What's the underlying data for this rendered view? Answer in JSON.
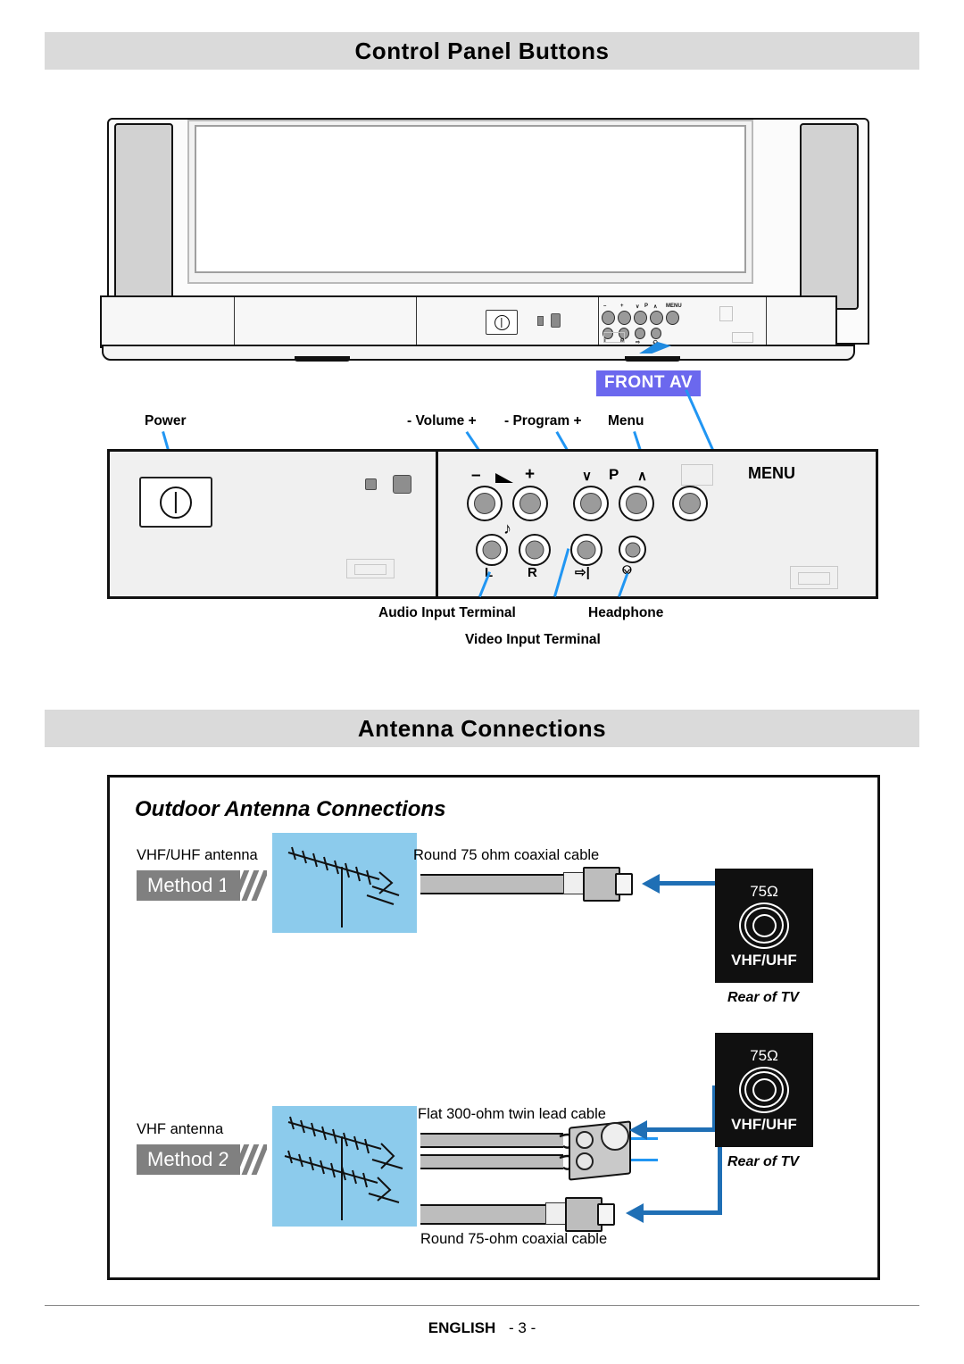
{
  "sections": {
    "control_panel_title": "Control Panel Buttons",
    "antenna_title": "Antenna Connections"
  },
  "control_panel": {
    "callouts": {
      "power": "Power",
      "volume": "- Volume +",
      "program": "- Program +",
      "menu": "Menu",
      "front_av": "FRONT AV",
      "audio_input": "Audio Input Terminal",
      "video_input": "Video Input Terminal",
      "headphone": "Headphone"
    },
    "top_row_labels": {
      "minus": "–",
      "plus": "+",
      "prog_down": "∨",
      "prog_letter": "P",
      "prog_up": "∧",
      "menu": "MENU"
    },
    "bottom_row_labels": {
      "music_note": "♪",
      "left": "L",
      "right": "R",
      "video_in": "→|",
      "headphone": "Ω"
    }
  },
  "antenna": {
    "subtitle": "Outdoor Antenna Connections",
    "method1": {
      "badge": "Method 1",
      "antenna_label": "VHF/UHF antenna",
      "cable_label": "Round 75 ohm coaxial cable",
      "jack_ohm": "75Ω",
      "jack_label": "VHF/UHF",
      "rear_caption": "Rear of TV"
    },
    "method2": {
      "badge": "Method 2",
      "antenna_label": "VHF antenna",
      "twin_lead_label": "Flat 300-ohm twin lead cable",
      "coax_label": "Round 75-ohm coaxial cable",
      "jack_ohm": "75Ω",
      "jack_label": "VHF/UHF",
      "rear_caption": "Rear of TV"
    }
  },
  "footer": {
    "language": "ENGLISH",
    "page": "- 3 -"
  },
  "colors": {
    "header_bar": "#dadada",
    "front_av_badge": "#6b68ee",
    "method_badge": "#808080",
    "antenna_backdrop": "#8ccbec",
    "arrow_blue": "#1f6fb5",
    "leader_blue": "#2196f3",
    "jack_black": "#101010"
  }
}
